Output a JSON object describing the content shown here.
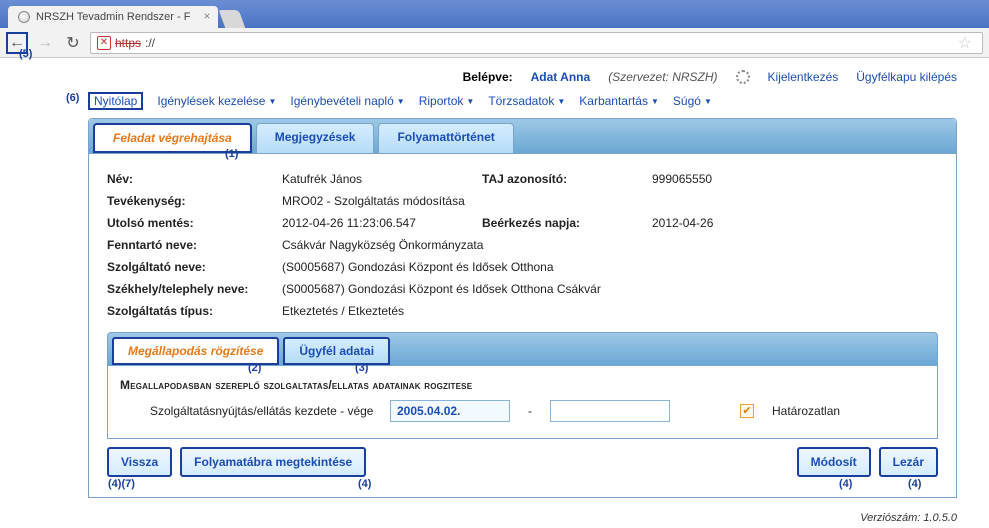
{
  "browser": {
    "tab_title": "NRSZH Tevadmin Rendszer - F",
    "url_strike": "https",
    "url_rest": "://"
  },
  "header": {
    "logged_label": "Belépve:",
    "user_name": "Adat Anna",
    "org": "(Szervezet: NRSZH)",
    "logout": "Kijelentkezés",
    "gate_logout": "Ügyfélkapu kilépés"
  },
  "menu": {
    "home": "Nyitólap",
    "req": "Igénylések kezelése",
    "log": "Igénybevételi napló",
    "reports": "Riportok",
    "master": "Törzsadatok",
    "maint": "Karbantartás",
    "help": "Súgó"
  },
  "tabs": {
    "t1": "Feladat végrehajtása",
    "t2": "Megjegyzések",
    "t3": "Folyamattörténet"
  },
  "fields": {
    "name_l": "Név:",
    "name_v": "Katufrék János",
    "taj_l": "TAJ azonosító:",
    "taj_v": "999065550",
    "act_l": "Tevékenység:",
    "act_v": "MRO02 - Szolgáltatás módosítása",
    "save_l": "Utolsó mentés:",
    "save_v": "2012-04-26 11:23:06.547",
    "recv_l": "Beérkezés napja:",
    "recv_v": "2012-04-26",
    "maint_l": "Fenntartó neve:",
    "maint_v": "Csákvár Nagyközség Önkormányzata",
    "provn_l": "Szolgáltató neve:",
    "provn_v": "(S0005687) Gondozási Központ és Idősek Otthona",
    "site_l": "Székhely/telephely neve:",
    "site_v": "(S0005687) Gondozási Központ és Idősek Otthona Csákvár",
    "type_l": "Szolgáltatás típus:",
    "type_v": "Etkeztetés / Etkeztetés"
  },
  "subtabs": {
    "s1": "Megállapodás rögzítése",
    "s2": "Ügyfél adatai"
  },
  "section": {
    "heading": "Megallapodasban szereplő szolgaltatas/ellatas adatainak rogzitese",
    "date_label": "Szolgáltatásnyújtás/ellátás kezdete - vége",
    "date_value": "2005.04.02.",
    "date_sep": "-",
    "indef_label": "Határozatlan"
  },
  "actions": {
    "back": "Vissza",
    "flow": "Folyamatábra megtekintése",
    "modify": "Módosít",
    "close": "Lezár"
  },
  "footer": {
    "version": "Verziószám: 1.0.5.0"
  },
  "annotations": {
    "a1": "(1)",
    "a2": "(2)",
    "a3": "(3)",
    "a4": "(4)",
    "a47": "(4)(7)",
    "a5": "(5)",
    "a6": "(6)"
  }
}
